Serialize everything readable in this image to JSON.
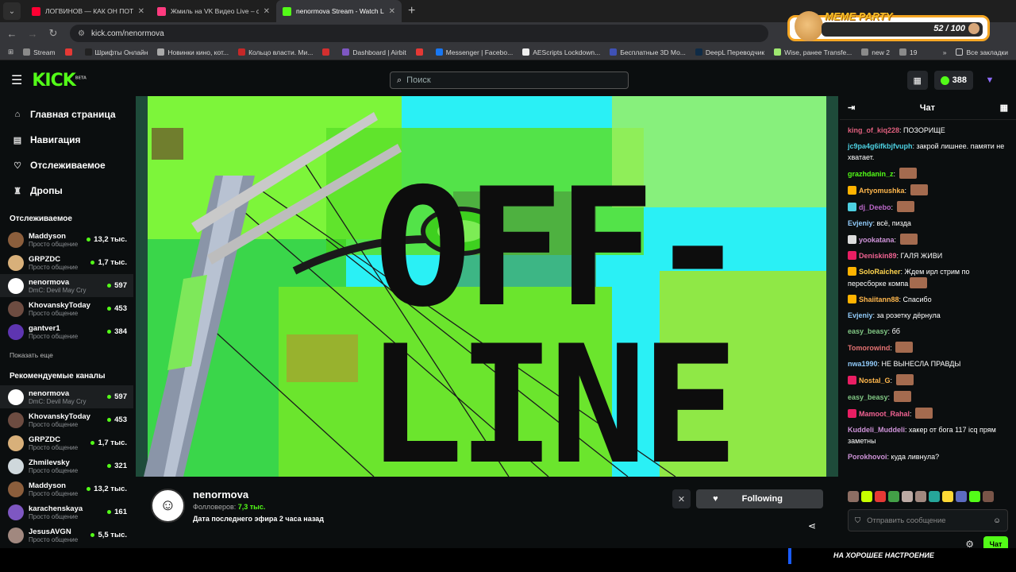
{
  "browser": {
    "tabs": [
      {
        "title": "ЛОГВИНОВ — КАК ОН ПОТЕР",
        "favicon_color": "#ff0033"
      },
      {
        "title": "Жмиль на VK Видео Live – смо",
        "favicon_color": "#ff3b7f"
      },
      {
        "title": "nenormova Stream - Watch Live",
        "favicon_color": "#53fc18",
        "active": true
      }
    ],
    "url": "kick.com/nenormova",
    "bookmarks": [
      {
        "label": "Stream",
        "color": "#8a8a8a"
      },
      {
        "label": "",
        "color": "#e53935"
      },
      {
        "label": "Шрифты Онлайн",
        "color": "#222"
      },
      {
        "label": "Новинки кино, кот...",
        "color": "#aaaaaa"
      },
      {
        "label": "Кольцо власти. Ми...",
        "color": "#c62828"
      },
      {
        "label": "",
        "color": "#d32f2f"
      },
      {
        "label": "Dashboard | Airbit",
        "color": "#7e57c2"
      },
      {
        "label": "",
        "color": "#e53935"
      },
      {
        "label": "Messenger | Facebo...",
        "color": "#1877f2"
      },
      {
        "label": "AEScripts Lockdown...",
        "color": "#eee"
      },
      {
        "label": "Бесплатные 3D Мо...",
        "color": "#3f51b5"
      },
      {
        "label": "DeepL Переводчик",
        "color": "#0f2b46"
      },
      {
        "label": "Wise, ранее Transfe...",
        "color": "#9fe870"
      },
      {
        "label": "new 2",
        "color": "#8a8a8a"
      },
      {
        "label": "19",
        "color": "#8a8a8a"
      }
    ],
    "all_bookmarks": "Все закладки"
  },
  "overlay": {
    "title": "MEME PARTY",
    "count": "52 / 100"
  },
  "header": {
    "logo": "KICK",
    "beta": "BETA",
    "search_placeholder": "Поиск",
    "points": "388"
  },
  "sidebar": {
    "nav": [
      {
        "label": "Главная страница",
        "icon": "home-icon",
        "glyph": "⌂"
      },
      {
        "label": "Навигация",
        "icon": "browse-icon",
        "glyph": "▤"
      },
      {
        "label": "Отслеживаемое",
        "icon": "heart-icon",
        "glyph": "♡"
      },
      {
        "label": "Дропы",
        "icon": "drops-icon",
        "glyph": "♜"
      }
    ],
    "following_title": "Отслеживаемое",
    "following": [
      {
        "name": "Maddyson",
        "cat": "Просто общение",
        "viewers": "13,2 тыс.",
        "color": "#8b5e3c"
      },
      {
        "name": "GRPZDC",
        "cat": "Просто общение",
        "viewers": "1,7 тыс.",
        "color": "#d8b07a"
      },
      {
        "name": "nenormova",
        "cat": "DmC: Devil May Cry",
        "viewers": "597",
        "color": "#ffffff",
        "selected": true
      },
      {
        "name": "KhovanskyToday",
        "cat": "Просто общение",
        "viewers": "453",
        "color": "#6d4c41"
      },
      {
        "name": "gantver1",
        "cat": "Просто общение",
        "viewers": "384",
        "color": "#5e35b1"
      }
    ],
    "show_more": "Показать еще",
    "recommended_title": "Рекомендуемые каналы",
    "recommended": [
      {
        "name": "nenormova",
        "cat": "DmC: Devil May Cry",
        "viewers": "597",
        "color": "#ffffff",
        "selected": true
      },
      {
        "name": "KhovanskyToday",
        "cat": "Просто общение",
        "viewers": "453",
        "color": "#6d4c41"
      },
      {
        "name": "GRPZDC",
        "cat": "Просто общение",
        "viewers": "1,7 тыс.",
        "color": "#d8b07a"
      },
      {
        "name": "Zhmilevsky",
        "cat": "Просто общение",
        "viewers": "321",
        "color": "#cfd8dc"
      },
      {
        "name": "Maddyson",
        "cat": "Просто общение",
        "viewers": "13,2 тыс.",
        "color": "#8b5e3c"
      },
      {
        "name": "karachenskaya",
        "cat": "Просто общение",
        "viewers": "161",
        "color": "#7e57c2"
      },
      {
        "name": "JesusAVGN",
        "cat": "Просто общение",
        "viewers": "5,5 тыс.",
        "color": "#a1887f"
      }
    ]
  },
  "player": {
    "line1": "OFF-",
    "line2": "LINE"
  },
  "channel": {
    "name": "nenormova",
    "followers_label": "Фолловеров:",
    "followers": "7,3 тыс.",
    "last_stream": "Дата последнего эфира 2 часа назад",
    "follow_label": "Following"
  },
  "chat": {
    "title": "Чат",
    "messages": [
      {
        "user": "king_of_kiq228",
        "color": "#e0607e",
        "text": "ПОЗОРИЩЕ"
      },
      {
        "user": "jc9pa4g6ifkbjfvuph",
        "color": "#4dd0e1",
        "text": "закрой лишнее. памяти не хватает."
      },
      {
        "user": "grazhdanin_z",
        "color": "#53fc18",
        "text": "",
        "emote": true
      },
      {
        "user": "Artyomushka",
        "color": "#ffb74d",
        "text": "",
        "badge": "#ffb300",
        "emote": true
      },
      {
        "user": "dj_Deebo",
        "color": "#ba68c8",
        "text": "",
        "badge": "#4dd0e1",
        "emote": true
      },
      {
        "user": "Evjeniy",
        "color": "#90caf9",
        "text": "всё, пизда"
      },
      {
        "user": "yookatana",
        "color": "#ce93d8",
        "text": "",
        "badge": "#ddd",
        "emote": true
      },
      {
        "user": "Deniskin89",
        "color": "#f06292",
        "text": "ГАЛЯ ЖИВИ",
        "badge": "#e91e63"
      },
      {
        "user": "SoloRaicher",
        "color": "#ffd54f",
        "text": "Ждем ирл стрим по пересборке компа",
        "badge": "#ffb300",
        "emote": true
      },
      {
        "user": "Shaiitann88",
        "color": "#ffb74d",
        "text": "Спасибо",
        "badge": "#ffb300"
      },
      {
        "user": "Evjeniy",
        "color": "#90caf9",
        "text": "за розетку дёрнула"
      },
      {
        "user": "easy_beasy",
        "color": "#81c784",
        "text": "бб"
      },
      {
        "user": "Tomorowind",
        "color": "#e57373",
        "text": "",
        "emote": true
      },
      {
        "user": "nwa1990",
        "color": "#90caf9",
        "text": "НЕ ВЫНЕСЛА ПРАВДЫ"
      },
      {
        "user": "Nostal_G",
        "color": "#ffb74d",
        "text": "",
        "badge": "#e91e63",
        "emote": true
      },
      {
        "user": "easy_beasy",
        "color": "#81c784",
        "text": "",
        "emote": true
      },
      {
        "user": "Mamoot_Rahal",
        "color": "#f06292",
        "text": "",
        "badge": "#e91e63",
        "emote": true
      },
      {
        "user": "Kuddeli_Muddeli",
        "color": "#ce93d8",
        "text": "хакер от бога 117 icq прям заметны"
      },
      {
        "user": "Porokhovoi",
        "color": "#ce93d8",
        "text": "куда ливнула?"
      }
    ],
    "input_placeholder": "Отправить сообщение",
    "send_label": "Чат"
  },
  "footer_text": "НА ХОРОШЕЕ НАСТРОЕНИЕ"
}
